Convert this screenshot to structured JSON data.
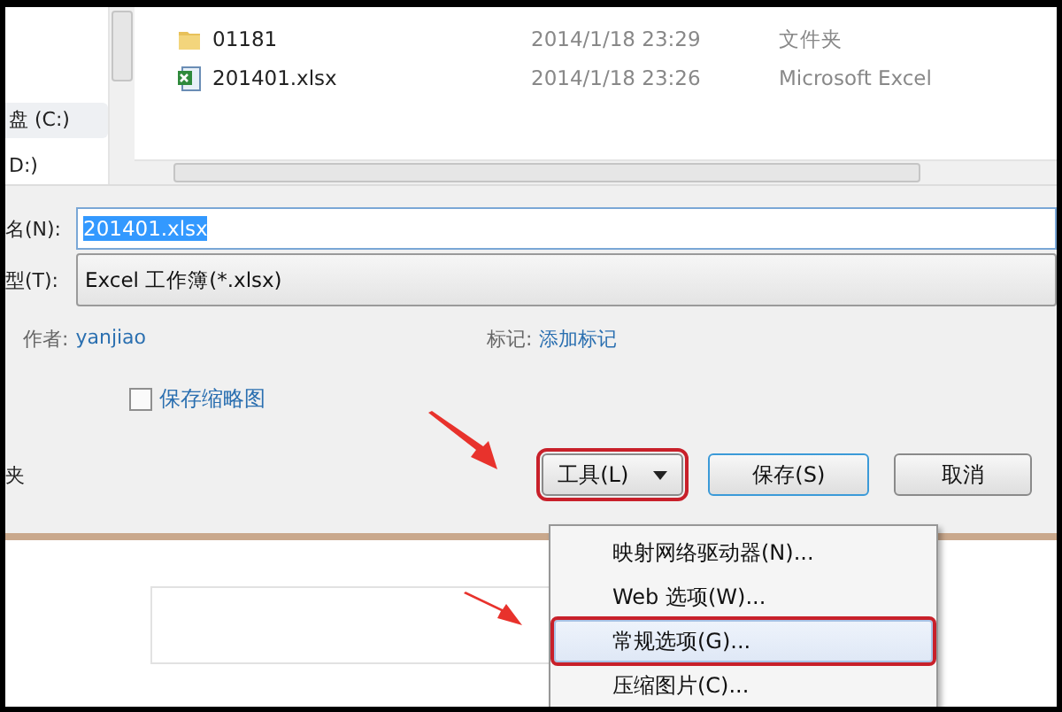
{
  "nav_pane": {
    "items": [
      {
        "label": "盘 (C:)",
        "selected": true
      },
      {
        "label": "D:)",
        "selected": false
      }
    ]
  },
  "file_list": {
    "rows": [
      {
        "kind": "folder",
        "name": "01181",
        "date": "2014/1/18 23:29",
        "type": "文件夹"
      },
      {
        "kind": "excel",
        "name": "201401.xlsx",
        "date": "2014/1/18 23:26",
        "type": "Microsoft Excel"
      }
    ]
  },
  "filename": {
    "label": "名(N):",
    "value": "201401.xlsx"
  },
  "file_type": {
    "label": "型(T):",
    "value": "Excel 工作簿(*.xlsx)"
  },
  "author": {
    "label": "作者:",
    "value": "yanjiao"
  },
  "tags": {
    "label": "标记:",
    "value": "添加标记"
  },
  "thumbnail_checkbox": {
    "label": "保存缩略图",
    "checked": false
  },
  "hide_folders": {
    "label": "夹"
  },
  "buttons": [
    {
      "kind": "dropdown",
      "label": "工具(L)",
      "annotated": true
    },
    {
      "kind": "default",
      "label": "保存(S)",
      "annotated": false
    },
    {
      "kind": "plain",
      "label": "取消",
      "annotated": false
    }
  ],
  "tools_menu": {
    "items": [
      {
        "label": "映射网络驱动器(N)...",
        "selected": false,
        "annotated": false
      },
      {
        "label": "Web 选项(W)...",
        "selected": false,
        "annotated": false
      },
      {
        "label": "常规选项(G)...",
        "selected": true,
        "annotated": true
      },
      {
        "label": "压缩图片(C)...",
        "selected": false,
        "annotated": false
      }
    ]
  }
}
